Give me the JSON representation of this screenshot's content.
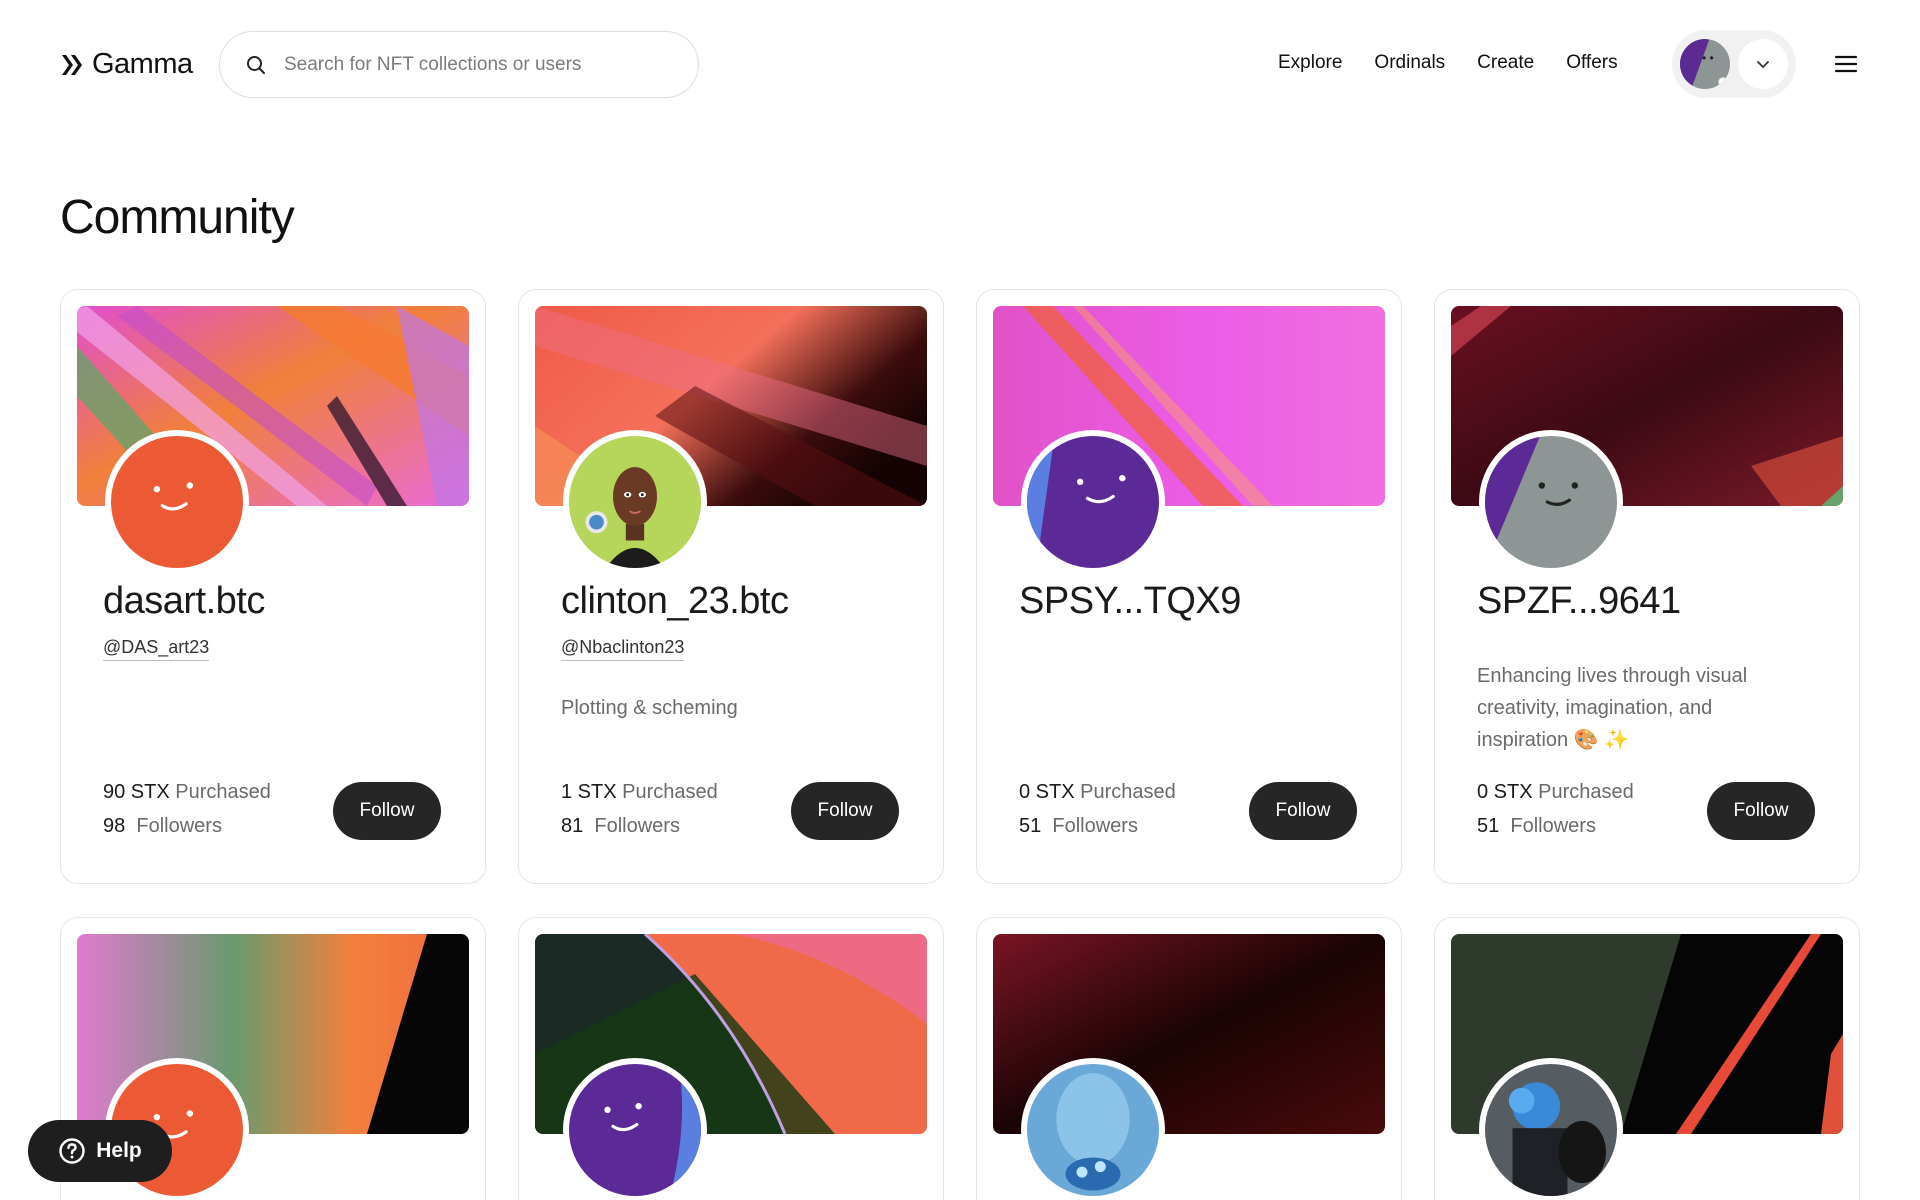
{
  "header": {
    "brand": "Gamma",
    "search_placeholder": "Search for NFT collections or users",
    "nav": [
      "Explore",
      "Ordinals",
      "Create",
      "Offers"
    ]
  },
  "page": {
    "title": "Community"
  },
  "cards": [
    {
      "name": "dasart.btc",
      "handle": "@DAS_art23",
      "bio": "",
      "stx": "90 STX",
      "purchased_label": "Purchased",
      "followers": "98",
      "followers_label": "Followers",
      "follow_label": "Follow"
    },
    {
      "name": "clinton_23.btc",
      "handle": "@Nbaclinton23",
      "bio": "Plotting & scheming",
      "stx": "1 STX",
      "purchased_label": "Purchased",
      "followers": "81",
      "followers_label": "Followers",
      "follow_label": "Follow"
    },
    {
      "name": "SPSY...TQX9",
      "handle": "",
      "bio": "",
      "stx": "0 STX",
      "purchased_label": "Purchased",
      "followers": "51",
      "followers_label": "Followers",
      "follow_label": "Follow"
    },
    {
      "name": "SPZF...9641",
      "handle": "",
      "bio": "Enhancing lives through visual creativity, imagination, and inspiration 🎨 ✨",
      "stx": "0 STX",
      "purchased_label": "Purchased",
      "followers": "51",
      "followers_label": "Followers",
      "follow_label": "Follow"
    }
  ],
  "help": {
    "label": "Help"
  },
  "colors": {
    "accent": "#262626",
    "orange_avatar": "#ec5a35",
    "purple_avatar": "#5c2a96",
    "gray_avatar": "#8e9595"
  }
}
